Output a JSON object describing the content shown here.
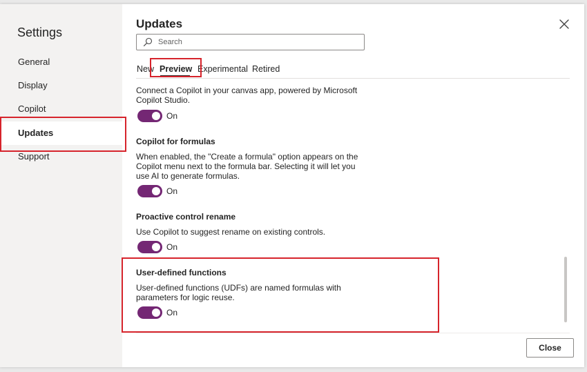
{
  "sidebar": {
    "title": "Settings",
    "items": [
      {
        "label": "General"
      },
      {
        "label": "Display"
      },
      {
        "label": "Copilot"
      },
      {
        "label": "Updates"
      },
      {
        "label": "Support"
      }
    ],
    "active_item": "Updates"
  },
  "main": {
    "title": "Updates",
    "search": {
      "placeholder": "Search",
      "value": ""
    },
    "tabs": [
      {
        "label": "New"
      },
      {
        "label": "Preview"
      },
      {
        "label": "Experimental"
      },
      {
        "label": "Retired"
      }
    ],
    "active_tab": "Preview",
    "features": [
      {
        "title": "",
        "description": "Connect a Copilot in your canvas app, powered by Microsoft Copilot Studio.",
        "state": "On"
      },
      {
        "title": "Copilot for formulas",
        "description": "When enabled, the \"Create a formula\" option appears on the Copilot menu next to the formula bar. Selecting it will let you use AI to generate formulas.",
        "state": "On"
      },
      {
        "title": "Proactive control rename",
        "description": "Use Copilot to suggest rename on existing controls.",
        "state": "On"
      },
      {
        "title": "User-defined functions",
        "description": "User-defined functions (UDFs) are named formulas with parameters for logic reuse.",
        "state": "On"
      }
    ]
  },
  "footer": {
    "close_label": "Close"
  },
  "colors": {
    "toggle_on": "#742774",
    "highlight": "#d6232b",
    "sidebar_bg": "#f3f2f1"
  },
  "icons": {
    "search": "search-icon",
    "dismiss": "close-icon"
  }
}
